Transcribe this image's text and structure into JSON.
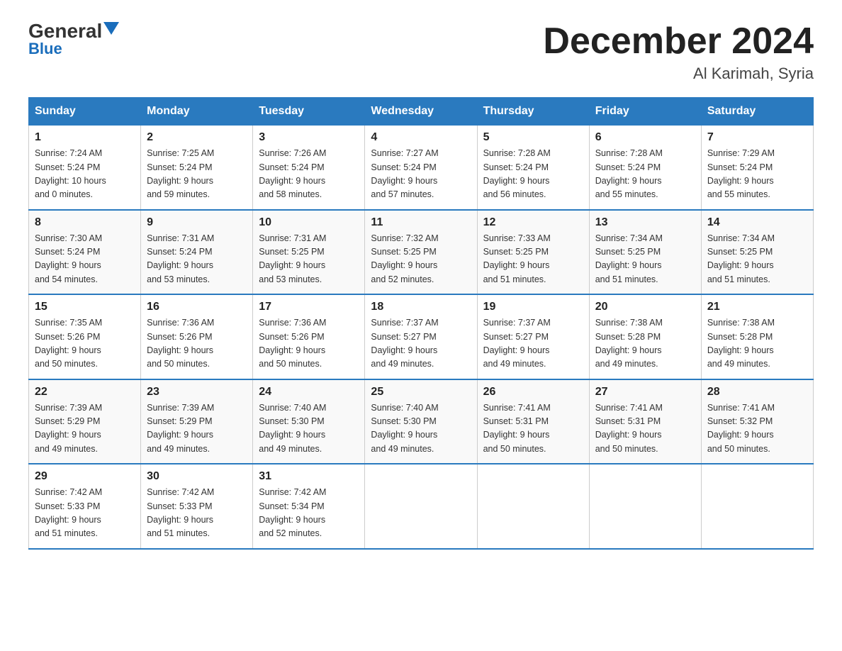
{
  "header": {
    "logo_general": "General",
    "logo_blue": "Blue",
    "month_title": "December 2024",
    "location": "Al Karimah, Syria"
  },
  "days_of_week": [
    "Sunday",
    "Monday",
    "Tuesday",
    "Wednesday",
    "Thursday",
    "Friday",
    "Saturday"
  ],
  "weeks": [
    [
      {
        "day": "1",
        "sunrise": "7:24 AM",
        "sunset": "5:24 PM",
        "daylight": "10 hours and 0 minutes."
      },
      {
        "day": "2",
        "sunrise": "7:25 AM",
        "sunset": "5:24 PM",
        "daylight": "9 hours and 59 minutes."
      },
      {
        "day": "3",
        "sunrise": "7:26 AM",
        "sunset": "5:24 PM",
        "daylight": "9 hours and 58 minutes."
      },
      {
        "day": "4",
        "sunrise": "7:27 AM",
        "sunset": "5:24 PM",
        "daylight": "9 hours and 57 minutes."
      },
      {
        "day": "5",
        "sunrise": "7:28 AM",
        "sunset": "5:24 PM",
        "daylight": "9 hours and 56 minutes."
      },
      {
        "day": "6",
        "sunrise": "7:28 AM",
        "sunset": "5:24 PM",
        "daylight": "9 hours and 55 minutes."
      },
      {
        "day": "7",
        "sunrise": "7:29 AM",
        "sunset": "5:24 PM",
        "daylight": "9 hours and 55 minutes."
      }
    ],
    [
      {
        "day": "8",
        "sunrise": "7:30 AM",
        "sunset": "5:24 PM",
        "daylight": "9 hours and 54 minutes."
      },
      {
        "day": "9",
        "sunrise": "7:31 AM",
        "sunset": "5:24 PM",
        "daylight": "9 hours and 53 minutes."
      },
      {
        "day": "10",
        "sunrise": "7:31 AM",
        "sunset": "5:25 PM",
        "daylight": "9 hours and 53 minutes."
      },
      {
        "day": "11",
        "sunrise": "7:32 AM",
        "sunset": "5:25 PM",
        "daylight": "9 hours and 52 minutes."
      },
      {
        "day": "12",
        "sunrise": "7:33 AM",
        "sunset": "5:25 PM",
        "daylight": "9 hours and 51 minutes."
      },
      {
        "day": "13",
        "sunrise": "7:34 AM",
        "sunset": "5:25 PM",
        "daylight": "9 hours and 51 minutes."
      },
      {
        "day": "14",
        "sunrise": "7:34 AM",
        "sunset": "5:25 PM",
        "daylight": "9 hours and 51 minutes."
      }
    ],
    [
      {
        "day": "15",
        "sunrise": "7:35 AM",
        "sunset": "5:26 PM",
        "daylight": "9 hours and 50 minutes."
      },
      {
        "day": "16",
        "sunrise": "7:36 AM",
        "sunset": "5:26 PM",
        "daylight": "9 hours and 50 minutes."
      },
      {
        "day": "17",
        "sunrise": "7:36 AM",
        "sunset": "5:26 PM",
        "daylight": "9 hours and 50 minutes."
      },
      {
        "day": "18",
        "sunrise": "7:37 AM",
        "sunset": "5:27 PM",
        "daylight": "9 hours and 49 minutes."
      },
      {
        "day": "19",
        "sunrise": "7:37 AM",
        "sunset": "5:27 PM",
        "daylight": "9 hours and 49 minutes."
      },
      {
        "day": "20",
        "sunrise": "7:38 AM",
        "sunset": "5:28 PM",
        "daylight": "9 hours and 49 minutes."
      },
      {
        "day": "21",
        "sunrise": "7:38 AM",
        "sunset": "5:28 PM",
        "daylight": "9 hours and 49 minutes."
      }
    ],
    [
      {
        "day": "22",
        "sunrise": "7:39 AM",
        "sunset": "5:29 PM",
        "daylight": "9 hours and 49 minutes."
      },
      {
        "day": "23",
        "sunrise": "7:39 AM",
        "sunset": "5:29 PM",
        "daylight": "9 hours and 49 minutes."
      },
      {
        "day": "24",
        "sunrise": "7:40 AM",
        "sunset": "5:30 PM",
        "daylight": "9 hours and 49 minutes."
      },
      {
        "day": "25",
        "sunrise": "7:40 AM",
        "sunset": "5:30 PM",
        "daylight": "9 hours and 49 minutes."
      },
      {
        "day": "26",
        "sunrise": "7:41 AM",
        "sunset": "5:31 PM",
        "daylight": "9 hours and 50 minutes."
      },
      {
        "day": "27",
        "sunrise": "7:41 AM",
        "sunset": "5:31 PM",
        "daylight": "9 hours and 50 minutes."
      },
      {
        "day": "28",
        "sunrise": "7:41 AM",
        "sunset": "5:32 PM",
        "daylight": "9 hours and 50 minutes."
      }
    ],
    [
      {
        "day": "29",
        "sunrise": "7:42 AM",
        "sunset": "5:33 PM",
        "daylight": "9 hours and 51 minutes."
      },
      {
        "day": "30",
        "sunrise": "7:42 AM",
        "sunset": "5:33 PM",
        "daylight": "9 hours and 51 minutes."
      },
      {
        "day": "31",
        "sunrise": "7:42 AM",
        "sunset": "5:34 PM",
        "daylight": "9 hours and 52 minutes."
      },
      null,
      null,
      null,
      null
    ]
  ],
  "labels": {
    "sunrise_prefix": "Sunrise: ",
    "sunset_prefix": "Sunset: ",
    "daylight_prefix": "Daylight: "
  }
}
